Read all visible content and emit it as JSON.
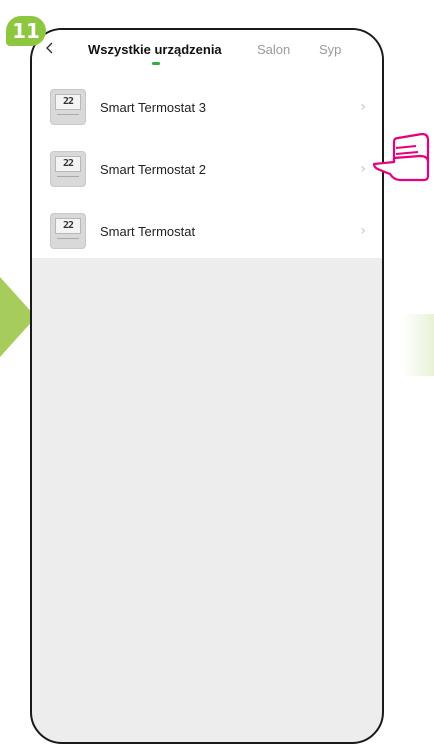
{
  "step": {
    "number": "11"
  },
  "tabs": [
    {
      "label": "Wszystkie urządzenia",
      "active": true
    },
    {
      "label": "Salon",
      "active": false
    },
    {
      "label": "Syp",
      "active": false
    }
  ],
  "devices": [
    {
      "name": "Smart Termostat 3",
      "display": "22"
    },
    {
      "name": "Smart Termostat 2",
      "display": "22"
    },
    {
      "name": "Smart Termostat",
      "display": "22"
    }
  ],
  "colors": {
    "accent": "#8dc63f",
    "tab_indicator": "#2fb043",
    "pointer": "#e6007e"
  },
  "icons": {
    "back": "chevron-left-icon",
    "row_arrow": "chevron-right-icon",
    "pointer": "pointing-hand-icon"
  }
}
